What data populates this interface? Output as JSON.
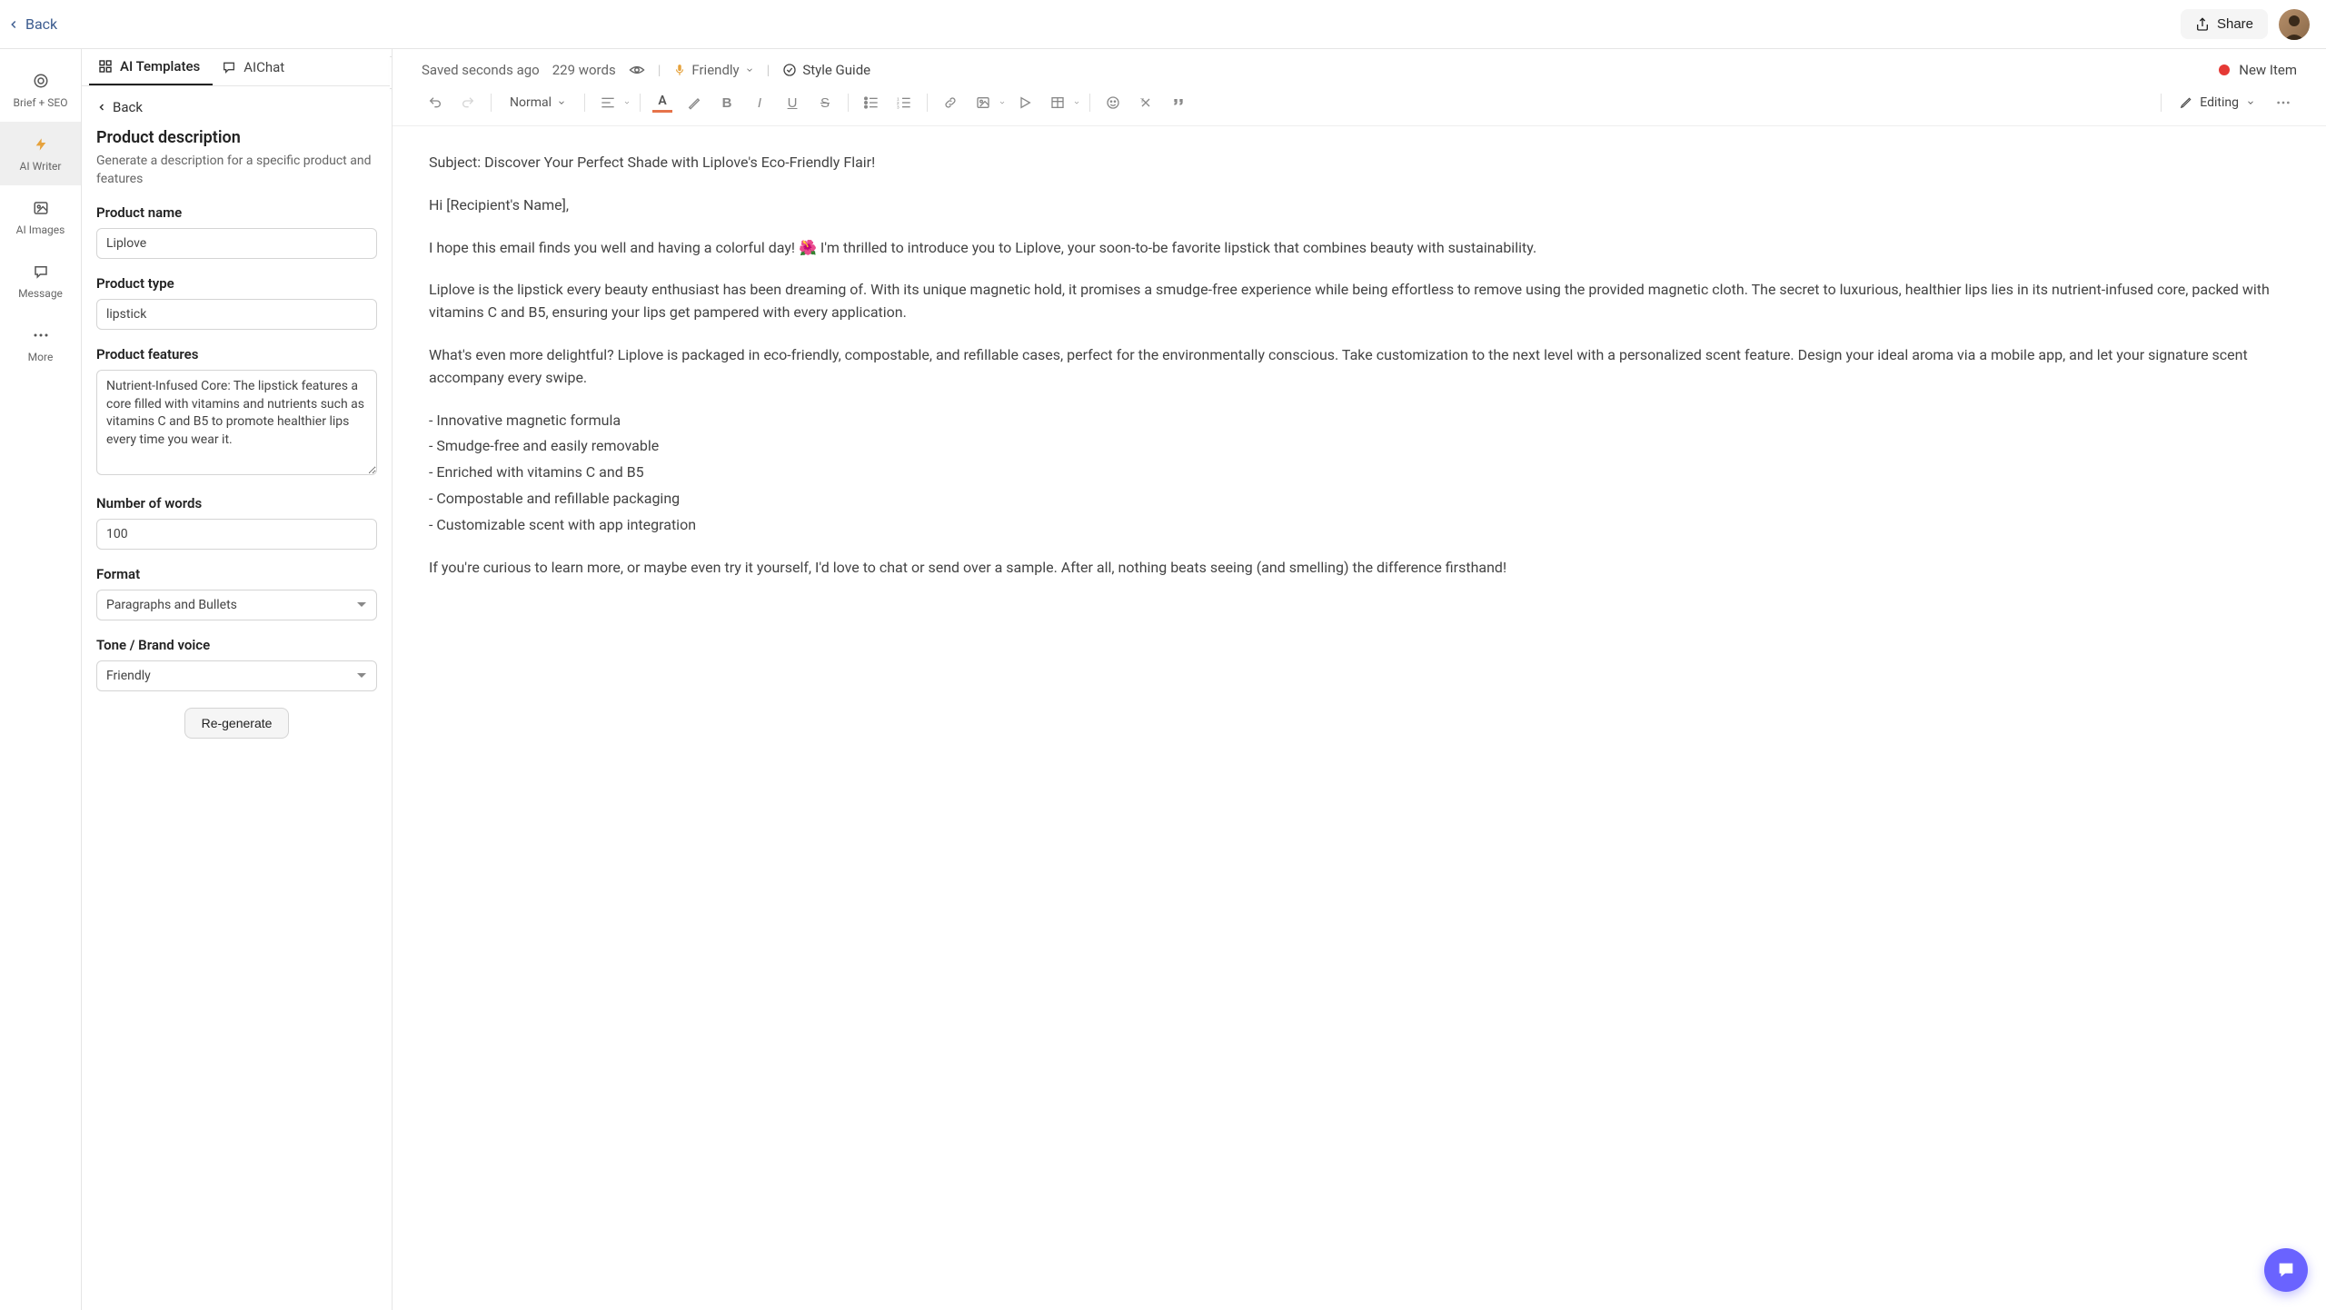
{
  "topbar": {
    "back_label": "Back",
    "share_label": "Share"
  },
  "rail": {
    "items": [
      {
        "id": "brief-seo",
        "label": "Brief + SEO"
      },
      {
        "id": "ai-writer",
        "label": "AI Writer"
      },
      {
        "id": "ai-images",
        "label": "AI Images"
      },
      {
        "id": "message",
        "label": "Message"
      },
      {
        "id": "more",
        "label": "More"
      }
    ]
  },
  "panel": {
    "tabs": {
      "templates_label": "AI Templates",
      "aichat_label": "AIChat"
    },
    "back_label": "Back",
    "title": "Product description",
    "subtitle": "Generate a description for a specific product and features",
    "fields": {
      "product_name": {
        "label": "Product name",
        "value": "Liplove"
      },
      "product_type": {
        "label": "Product type",
        "value": "lipstick"
      },
      "product_features": {
        "label": "Product features",
        "value": "Nutrient-Infused Core: The lipstick features a core filled with vitamins and nutrients such as vitamins C and B5 to promote healthier lips every time you wear it."
      },
      "number_of_words": {
        "label": "Number of words",
        "value": "100"
      },
      "format": {
        "label": "Format",
        "value": "Paragraphs and Bullets"
      },
      "tone": {
        "label": "Tone / Brand voice",
        "value": "Friendly"
      }
    },
    "regen_label": "Re-generate"
  },
  "editor": {
    "saved_text": "Saved seconds ago",
    "word_count": "229 words",
    "tone_display": "Friendly",
    "style_guide_label": "Style Guide",
    "status_label": "New Item",
    "para_type": "Normal",
    "editing_mode": "Editing"
  },
  "document": {
    "subject": "Subject: Discover Your Perfect Shade with Liplove's Eco-Friendly Flair!",
    "greeting": "Hi [Recipient's Name],",
    "p1": "I hope this email finds you well and having a colorful day! 🌺 I'm thrilled to introduce you to Liplove, your soon-to-be favorite lipstick that combines beauty with sustainability.",
    "p2": "Liplove is the lipstick every beauty enthusiast has been dreaming of. With its unique magnetic hold, it promises a smudge-free experience while being effortless to remove using the provided magnetic cloth. The secret to luxurious, healthier lips lies in its nutrient-infused core, packed with vitamins C and B5, ensuring your lips get pampered with every application.",
    "p3": "What's even more delightful? Liplove is packaged in eco-friendly, compostable, and refillable cases, perfect for the environmentally conscious. Take customization to the next level with a personalized scent feature. Design your ideal aroma via a mobile app, and let your signature scent accompany every swipe.",
    "bullets": [
      "- Innovative magnetic formula",
      "- Smudge-free and easily removable",
      "- Enriched with vitamins C and B5",
      "- Compostable and refillable packaging",
      "- Customizable scent with app integration"
    ],
    "p4": "If you're curious to learn more, or maybe even try it yourself, I'd love to chat or send over a sample. After all, nothing beats seeing (and smelling) the difference firsthand!"
  }
}
